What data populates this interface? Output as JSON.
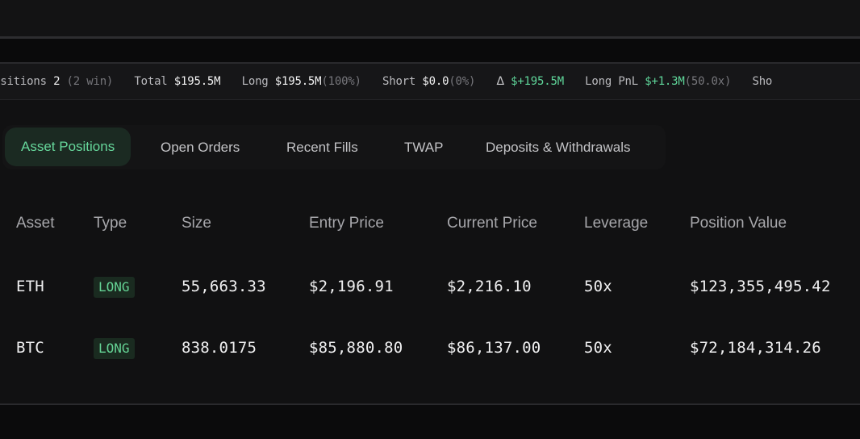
{
  "stats": {
    "positions_label": "ositions",
    "positions_count": "2",
    "positions_sub": "(2 win)",
    "total_label": "Total",
    "total_value": "$195.5M",
    "long_label": "Long",
    "long_value": "$195.5M",
    "long_pct": "(100%)",
    "short_label": "Short",
    "short_value": "$0.0",
    "short_pct": "(0%)",
    "delta_symbol": "Δ",
    "delta_value": "$+195.5M",
    "long_pnl_label": "Long PnL",
    "long_pnl_value": "$+1.3M",
    "long_pnl_mult": "(50.0x)",
    "short_pnl_label_cut": "Sho"
  },
  "tabs": [
    {
      "label": "Asset Positions",
      "active": true
    },
    {
      "label": "Open Orders",
      "active": false
    },
    {
      "label": "Recent Fills",
      "active": false
    },
    {
      "label": "TWAP",
      "active": false
    },
    {
      "label": "Deposits & Withdrawals",
      "active": false
    }
  ],
  "table": {
    "headers": [
      "Asset",
      "Type",
      "Size",
      "Entry Price",
      "Current Price",
      "Leverage",
      "Position Value"
    ],
    "rows": [
      {
        "asset": "ETH",
        "type": "LONG",
        "size": "55,663.33",
        "entry": "$2,196.91",
        "current": "$2,216.10",
        "leverage": "50x",
        "value": "$123,355,495.42"
      },
      {
        "asset": "BTC",
        "type": "LONG",
        "size": "838.0175",
        "entry": "$85,880.80",
        "current": "$86,137.00",
        "leverage": "50x",
        "value": "$72,184,314.26"
      }
    ]
  },
  "colors": {
    "accent_green": "#66d79b",
    "background": "#0f0f10"
  }
}
